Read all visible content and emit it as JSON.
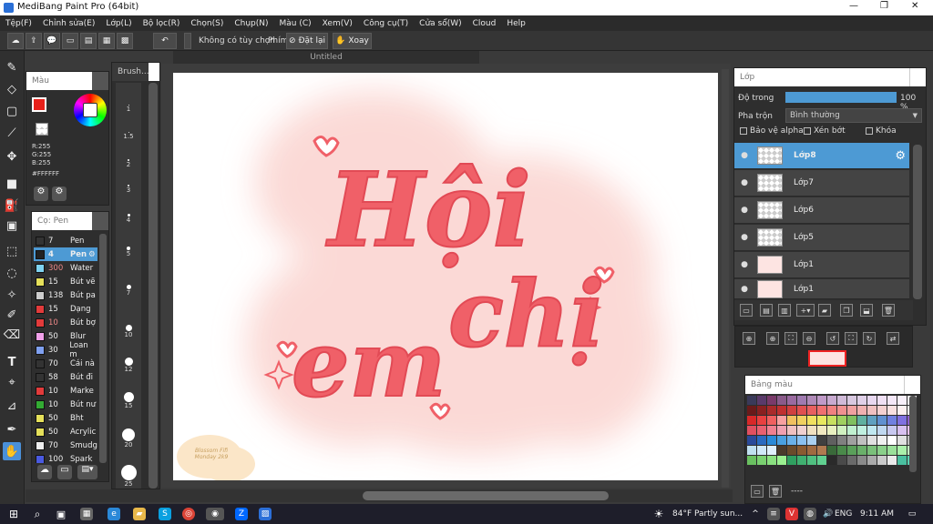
{
  "window": {
    "title": "MediBang Paint Pro (64bit)",
    "minimize_glyph": "—",
    "maximize_glyph": "❐",
    "close_glyph": "✕"
  },
  "menu": [
    "Tệp(F)",
    "Chỉnh sửa(E)",
    "Lớp(L)",
    "Bộ lọc(R)",
    "Chọn(S)",
    "Chụp(N)",
    "Màu (C)",
    "Xem(V)",
    "Công cụ(T)",
    "Cửa sổ(W)",
    "Cloud",
    "Help"
  ],
  "toolbar": {
    "no_option": "Không có tùy chọn",
    "keys_label": "Phím",
    "reset_label": "Đặt lại",
    "rotate_label": "Xoay"
  },
  "document_tab": "Untitled",
  "color_panel": {
    "title": "Màu",
    "r": "R:255",
    "g": "G:255",
    "b": "B:255",
    "hex": "#FFFFFF",
    "primary_color": "#e8201a"
  },
  "brush_panel": {
    "title": "Brush...",
    "sizes": [
      "1",
      "1.5",
      "2",
      "3",
      "4",
      "5",
      "7",
      "10",
      "12",
      "15",
      "20",
      "25"
    ]
  },
  "brush_list": {
    "title": "Cọ: Pen",
    "items": [
      {
        "size": "7",
        "name": "Pen",
        "color": "#333333"
      },
      {
        "size": "4",
        "name": "Pen",
        "color": "#222222",
        "selected": true
      },
      {
        "size": "300",
        "name": "Water",
        "color": "#7fd3f0"
      },
      {
        "size": "15",
        "name": "Bút vẽ",
        "color": "#e5e05a"
      },
      {
        "size": "138",
        "name": "Bút pa",
        "color": "#cccccc"
      },
      {
        "size": "15",
        "name": "Dạng",
        "color": "#e23b3b"
      },
      {
        "size": "10",
        "name": "Bút bợ",
        "color": "#e23b3b"
      },
      {
        "size": "50",
        "name": "Blur",
        "color": "#f0a0e8"
      },
      {
        "size": "30",
        "name": "Loan m",
        "color": "#7fa0f0"
      },
      {
        "size": "70",
        "name": "Cái nà",
        "color": "#333333"
      },
      {
        "size": "58",
        "name": "Bút đi",
        "color": "#333333"
      },
      {
        "size": "10",
        "name": "Marke",
        "color": "#e23b3b"
      },
      {
        "size": "10",
        "name": "Bút nư",
        "color": "#33aa33"
      },
      {
        "size": "50",
        "name": "Bht",
        "color": "#e5e05a"
      },
      {
        "size": "50",
        "name": "Acrylic",
        "color": "#e5e05a"
      },
      {
        "size": "70",
        "name": "Smudg",
        "color": "#eeeeee"
      },
      {
        "size": "100",
        "name": "Spark",
        "color": "#4a5ae0"
      }
    ]
  },
  "canvas": {
    "title_line1": "Hội",
    "title_line2": "chị",
    "title_line3": "em",
    "signature": "Blossom Fifi\nMonday 2k9",
    "lettering_color": "#f06068",
    "blob_color": "#fbd8d4"
  },
  "layer_panel": {
    "title": "Lớp",
    "opacity_label": "Độ trong",
    "opacity_value": "100 %",
    "opacity": 1.0,
    "blend_label": "Pha trộn",
    "blend_value": "Bình thường",
    "protect_alpha": "Bảo vệ alpha",
    "clipping": "Xén bớt",
    "lock": "Khóa",
    "layers": [
      "Lớp8",
      "Lớp7",
      "Lớp6",
      "Lớp5",
      "Lớp1",
      "Lớp1"
    ],
    "active_layer_color": "#4d9ad4"
  },
  "palette_panel": {
    "title": "Bảng màu",
    "footer": "----"
  },
  "taskbar": {
    "weather": "84°F  Partly sun...",
    "language": "ENG",
    "time": "9:11 AM"
  }
}
